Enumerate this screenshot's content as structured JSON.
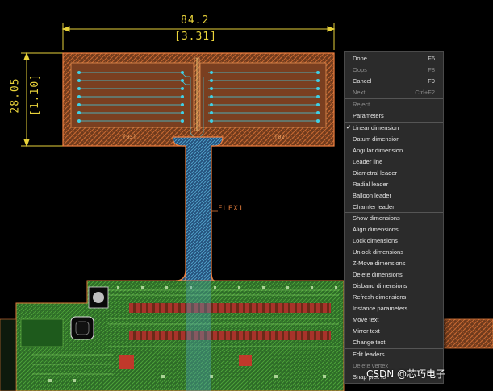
{
  "dimensions": {
    "horizontal_value": "84.2",
    "horizontal_alt": "[3.31]",
    "vertical_value": "28.05",
    "vertical_alt": "[1.10]"
  },
  "flex_label": "FLEX1",
  "context_menu": {
    "sections": [
      [
        {
          "label": "Done",
          "shortcut": "F6",
          "disabled": false
        },
        {
          "label": "Oops",
          "shortcut": "F8",
          "disabled": true
        },
        {
          "label": "Cancel",
          "shortcut": "F9",
          "disabled": false
        },
        {
          "label": "Next",
          "shortcut": "Ctrl+F2",
          "disabled": true
        }
      ],
      [
        {
          "label": "Reject",
          "shortcut": "",
          "disabled": true
        }
      ],
      [
        {
          "label": "Parameters",
          "shortcut": "",
          "disabled": false
        }
      ],
      [
        {
          "label": "Linear dimension",
          "shortcut": "",
          "disabled": false,
          "checked": true
        },
        {
          "label": "Datum dimension",
          "shortcut": "",
          "disabled": false
        },
        {
          "label": "Angular dimension",
          "shortcut": "",
          "disabled": false
        },
        {
          "label": "Leader line",
          "shortcut": "",
          "disabled": false
        },
        {
          "label": "Diametral leader",
          "shortcut": "",
          "disabled": false
        },
        {
          "label": "Radial leader",
          "shortcut": "",
          "disabled": false
        },
        {
          "label": "Balloon leader",
          "shortcut": "",
          "disabled": false
        },
        {
          "label": "Chamfer leader",
          "shortcut": "",
          "disabled": false
        }
      ],
      [
        {
          "label": "Show dimensions",
          "shortcut": "",
          "disabled": false
        },
        {
          "label": "Align dimensions",
          "shortcut": "",
          "disabled": false
        },
        {
          "label": "Lock dimensions",
          "shortcut": "",
          "disabled": false
        },
        {
          "label": "Unlock dimensions",
          "shortcut": "",
          "disabled": false
        },
        {
          "label": "Z-Move dimensions",
          "shortcut": "",
          "disabled": false
        },
        {
          "label": "Delete dimensions",
          "shortcut": "",
          "disabled": false
        },
        {
          "label": "Disband dimensions",
          "shortcut": "",
          "disabled": false
        },
        {
          "label": "Refresh dimensions",
          "shortcut": "",
          "disabled": false
        },
        {
          "label": "Instance parameters",
          "shortcut": "",
          "disabled": false
        }
      ],
      [
        {
          "label": "Move text",
          "shortcut": "",
          "disabled": false
        },
        {
          "label": "Mirror text",
          "shortcut": "",
          "disabled": false
        },
        {
          "label": "Change text",
          "shortcut": "",
          "disabled": false
        }
      ],
      [
        {
          "label": "Edit leaders",
          "shortcut": "",
          "disabled": false
        },
        {
          "label": "Delete vertex",
          "shortcut": "",
          "disabled": true
        },
        {
          "label": "Snap pick to",
          "shortcut": "",
          "disabled": false
        }
      ]
    ]
  },
  "watermark": "CSDN @芯巧电子",
  "colors": {
    "dimension": "#e8d23a",
    "outline": "#e07a3a",
    "trace_cyan": "#3fd0e6",
    "pcb_green": "#3c8f2e",
    "menu_bg": "#2b2b2b"
  }
}
